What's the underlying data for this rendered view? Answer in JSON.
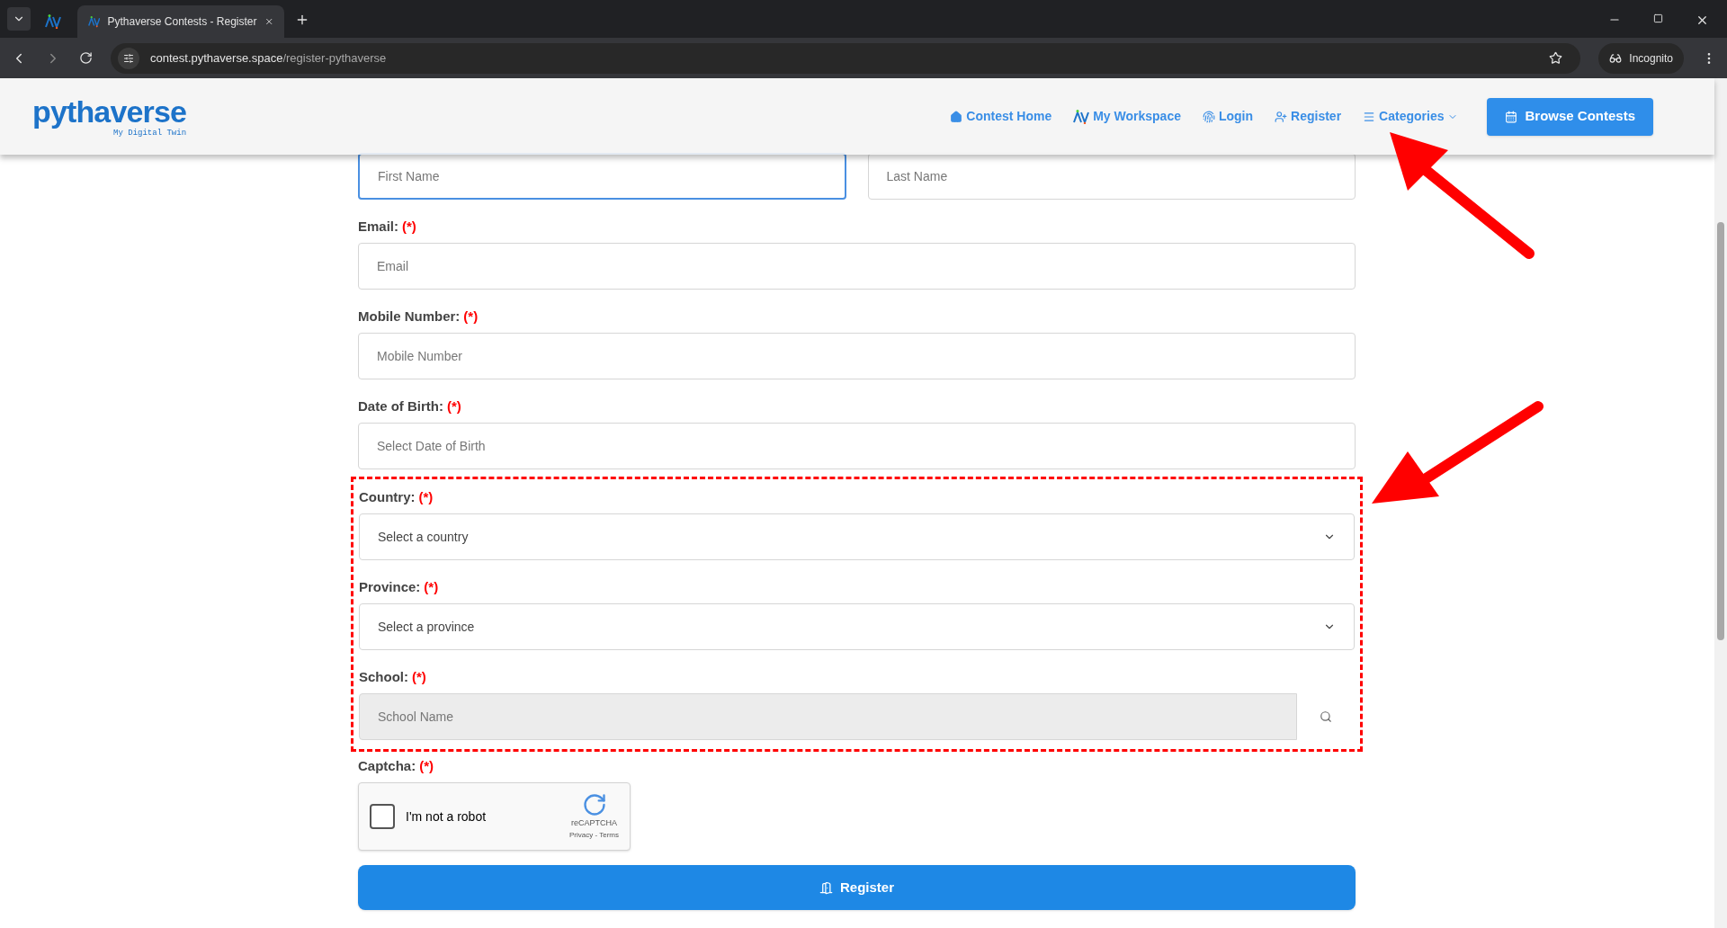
{
  "browser": {
    "tabs": [
      {
        "selected": false
      },
      {
        "title": "Pythaverse Contests - Register",
        "selected": true
      }
    ],
    "url_host": "contest.pythaverse.space",
    "url_path": "/register-pythaverse",
    "profile": "Incognito"
  },
  "header": {
    "logo": "pythaverse",
    "tagline": "My Digital Twin",
    "nav": [
      {
        "kind": "home",
        "label": "Contest Home"
      },
      {
        "kind": "workspace",
        "label": "My Workspace"
      },
      {
        "kind": "login",
        "label": "Login"
      },
      {
        "kind": "register",
        "label": "Register"
      },
      {
        "kind": "categories",
        "label": "Categories"
      }
    ],
    "cta": "Browse Contests"
  },
  "form": {
    "rows": [
      [
        {
          "kind": "input",
          "placeholder": "First Name",
          "focused": true
        },
        {
          "kind": "input",
          "placeholder": "Last Name",
          "focused": false
        }
      ],
      [
        {
          "kind": "input",
          "label": "Email:",
          "required": "(*)",
          "placeholder": "Email",
          "focused": false
        }
      ],
      [
        {
          "kind": "input",
          "label": "Mobile Number:",
          "required": "(*)",
          "placeholder": "Mobile Number",
          "focused": false
        }
      ],
      [
        {
          "kind": "input",
          "label": "Date of Birth:",
          "required": "(*)",
          "placeholder": "Select Date of Birth",
          "focused": false
        }
      ]
    ],
    "highlighted": [
      {
        "kind": "select",
        "label": "Country:",
        "required": "(*)",
        "placeholder": "Select a country"
      },
      {
        "kind": "select",
        "label": "Province:",
        "required": "(*)",
        "placeholder": "Select a province"
      },
      {
        "kind": "search",
        "label": "School:",
        "required": "(*)",
        "placeholder": "School Name"
      }
    ],
    "captcha": {
      "label": "Captcha:",
      "required": "(*)",
      "checkbox_label": "I'm not a robot",
      "checked": false,
      "brand": "reCAPTCHA",
      "links": "Privacy - Terms"
    },
    "submit": "Register"
  }
}
